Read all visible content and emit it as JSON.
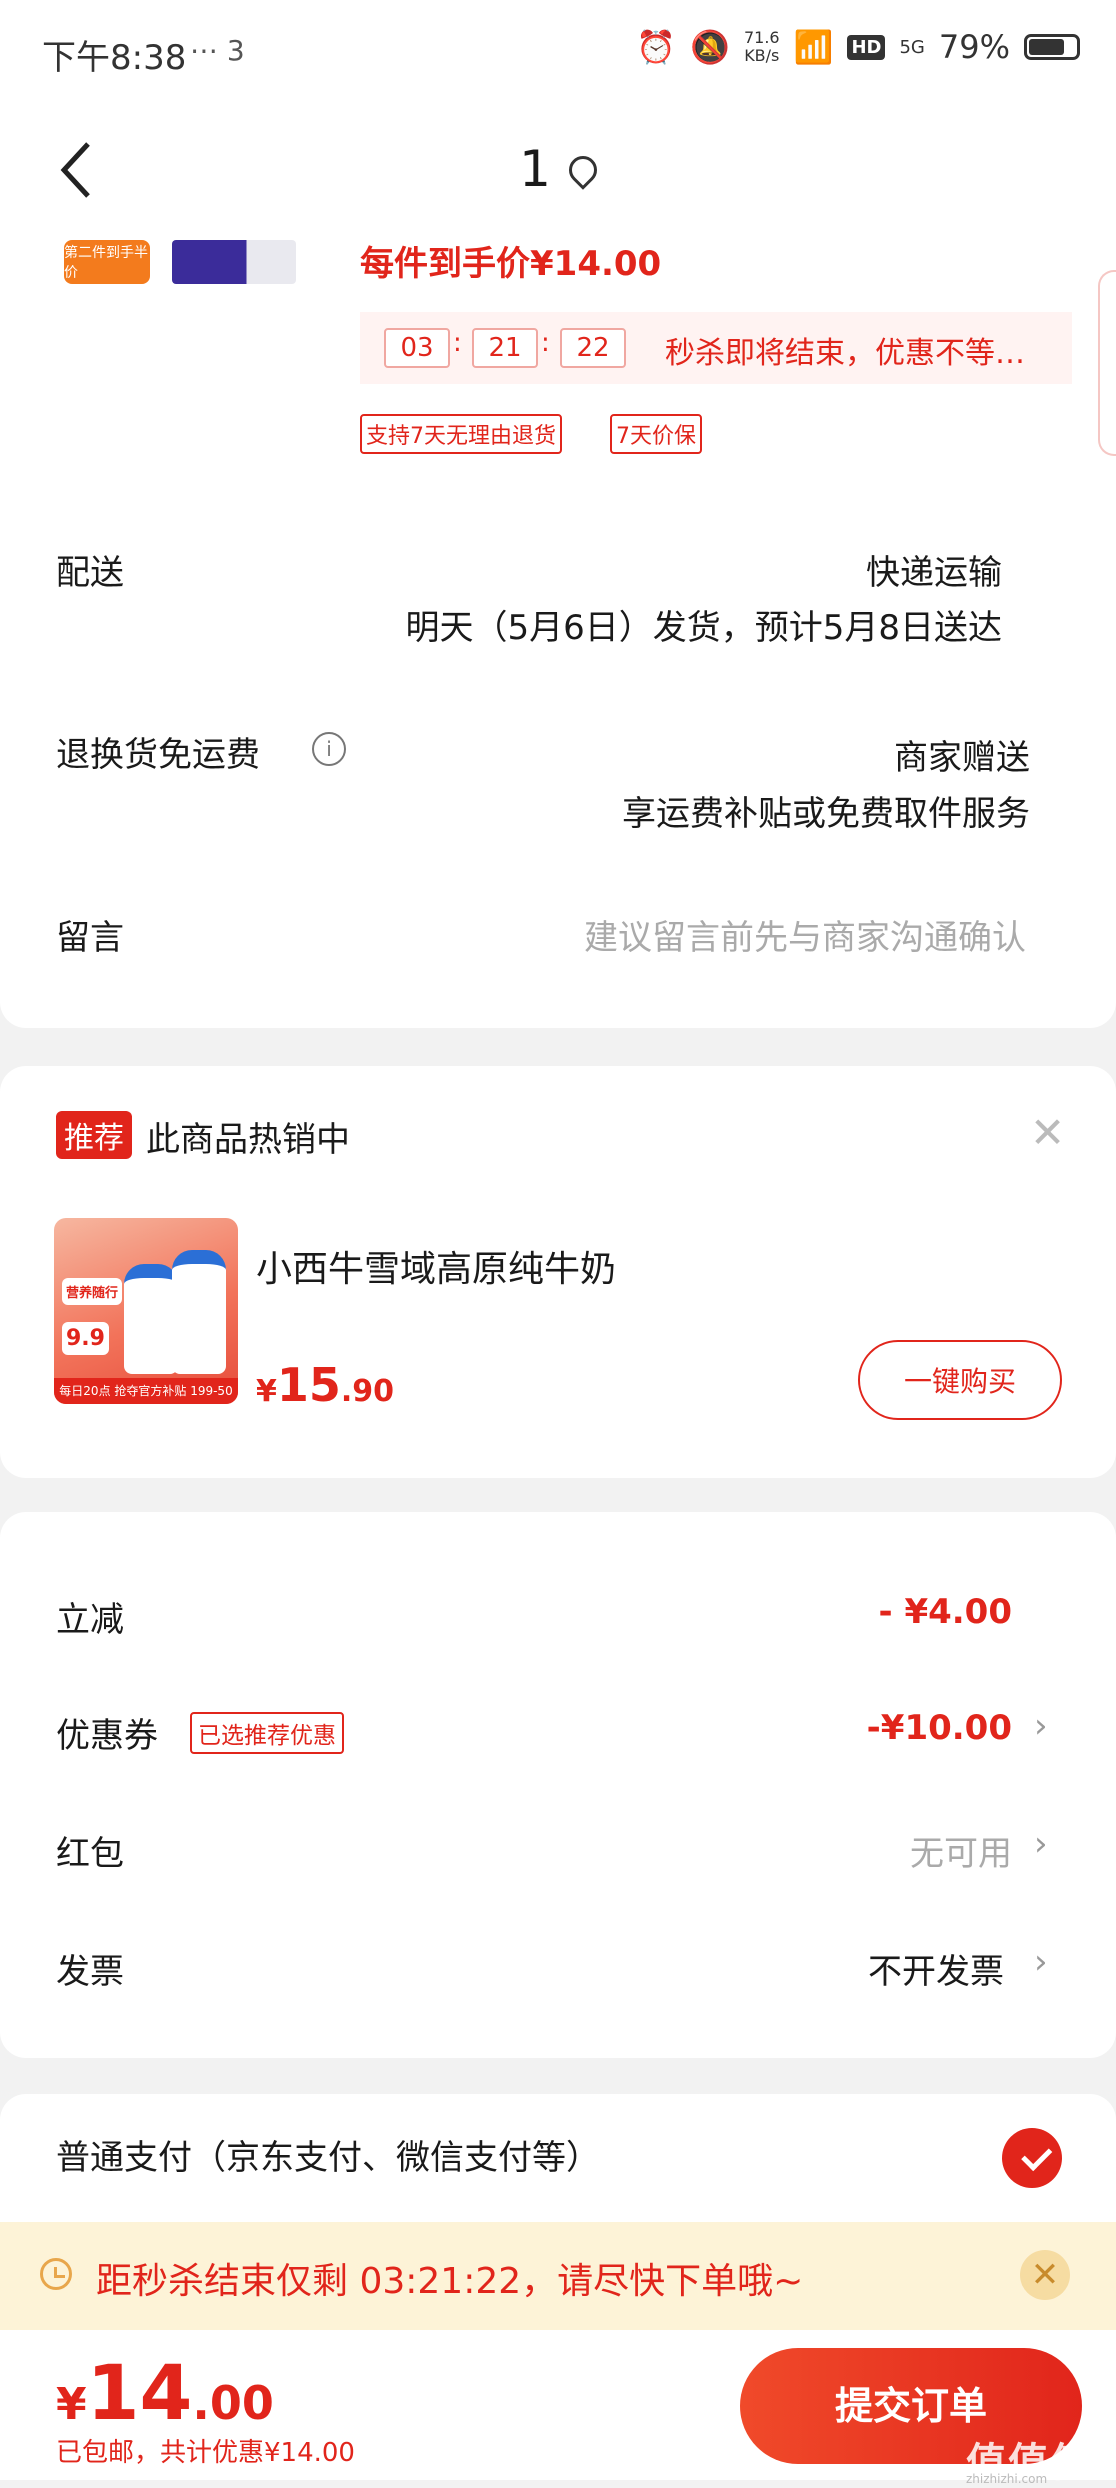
{
  "status_bar": {
    "time": "下午8:38",
    "notif_count": "3",
    "net_speed": "71.6",
    "net_unit": "KB/s",
    "hd": "HD",
    "signal": "5G",
    "battery": "79%"
  },
  "header": {
    "title": "1"
  },
  "product": {
    "thumb_label": "第二件到手半价",
    "unit_price": "每件到手价¥14.00",
    "countdown": {
      "h": "03",
      "m": "21",
      "s": "22"
    },
    "flash_text": "秒杀即将结束，优惠不等…",
    "tags": [
      "支持7天无理由退货",
      "7天价保"
    ]
  },
  "delivery": {
    "label": "配送",
    "method": "快递运输",
    "eta": "明天（5月6日）发货，预计5月8日送达"
  },
  "return_shipping": {
    "label": "退换货免运费",
    "value": "商家赠送",
    "desc": "享运费补贴或免费取件服务"
  },
  "message": {
    "label": "留言",
    "placeholder": "建议留言前先与商家沟通确认"
  },
  "recommend": {
    "badge": "推荐",
    "title": "此商品热销中",
    "image_texts": {
      "promo": "营养随行",
      "price": "9.9",
      "strip": "每日20点 抢夺官方补贴 199-50"
    },
    "product_name": "小西牛雪域高原纯牛奶",
    "price_symbol": "¥",
    "price_int": "15",
    "price_dec": ".90",
    "buy_label": "一键购买"
  },
  "discounts": {
    "instant": {
      "label": "立减",
      "value": "- ¥4.00"
    },
    "coupon": {
      "label": "优惠券",
      "tag": "已选推荐优惠",
      "value": "-¥10.00"
    },
    "redpacket": {
      "label": "红包",
      "value": "无可用"
    },
    "invoice": {
      "label": "发票",
      "value": "不开发票"
    }
  },
  "payment": {
    "label": "普通支付（京东支付、微信支付等）"
  },
  "notice": {
    "text": "距秒杀结束仅剩 03:21:22，请尽快下单哦~"
  },
  "footer": {
    "currency": "¥",
    "total_int": "14",
    "total_dec": ".00",
    "sub": "已包邮，共计优惠¥14.00",
    "submit_label": "提交订单",
    "watermark": "值值值",
    "watermark_url": "zhizhizhi.com"
  },
  "colors": {
    "accent": "#e1251b",
    "notice_bg": "#fdf3d7"
  }
}
